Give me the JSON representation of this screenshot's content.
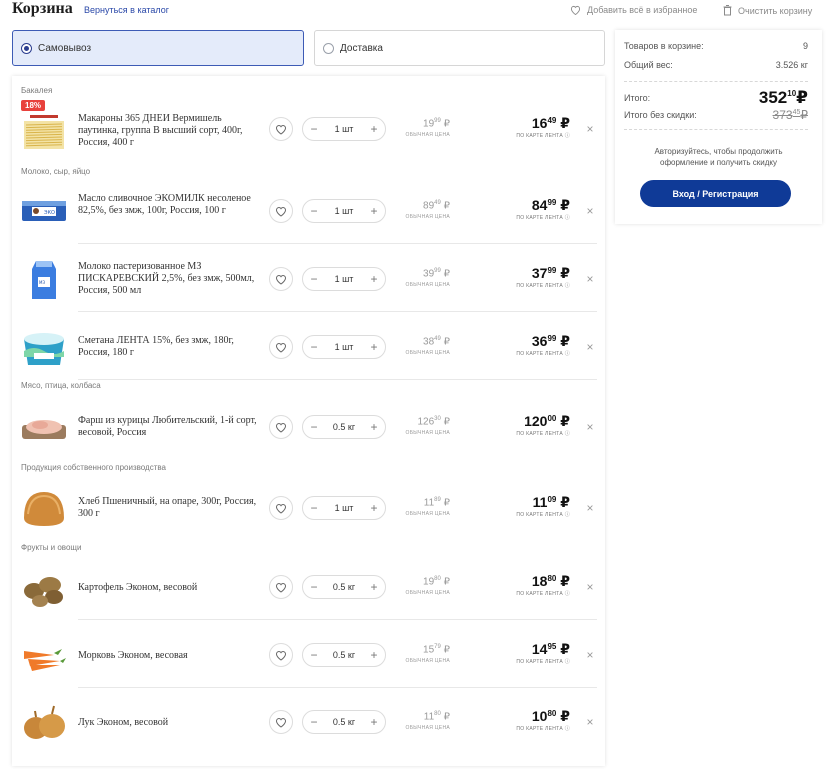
{
  "header": {
    "title": "Корзина",
    "back_link": "Вернуться в каталог",
    "add_all_favorites": "Добавить всё в избранное",
    "clear_cart": "Очистить корзину"
  },
  "delivery": {
    "pickup": "Самовывоз",
    "courier": "Доставка",
    "selected": "pickup"
  },
  "labels": {
    "regular_price": "ОБЫЧНАЯ ЦЕНА",
    "card_price": "ПО КАРТЕ ЛЕНТА ⓘ",
    "currency": "₽"
  },
  "categories": [
    {
      "name": "Бакалея"
    },
    {
      "name": "Молоко, сыр, яйцо"
    },
    {
      "name": "Мясо, птица, колбаса"
    },
    {
      "name": "Продукция собственного производства"
    },
    {
      "name": "Фрукты и овощи"
    }
  ],
  "items": [
    {
      "name": "Макароны 365 ДНЕИ Вермишель паутинка, группа В высший сорт, 400г, Россия, 400 г",
      "qty": "1 шт",
      "old_int": "19",
      "old_frac": "99",
      "price_int": "16",
      "price_frac": "49",
      "badge": "18%",
      "image": "pasta-image"
    },
    {
      "name": "Масло сливочное ЭКОМИЛК несоленое 82,5%, без змж, 100г, Россия, 100 г",
      "qty": "1 шт",
      "old_int": "89",
      "old_frac": "49",
      "price_int": "84",
      "price_frac": "99",
      "image": "butter-image"
    },
    {
      "name": "Молоко пастеризованное МЗ ПИСКАРЕВСКИЙ 2,5%, без змж, 500мл, Россия, 500 мл",
      "qty": "1 шт",
      "old_int": "39",
      "old_frac": "99",
      "price_int": "37",
      "price_frac": "99",
      "image": "milk-image"
    },
    {
      "name": "Сметана ЛЕНТА 15%, без змж, 180г, Россия, 180 г",
      "qty": "1 шт",
      "old_int": "38",
      "old_frac": "49",
      "price_int": "36",
      "price_frac": "99",
      "image": "sour-cream-image"
    },
    {
      "name": "Фарш из курицы Любительский, 1-й сорт, весовой, Россия",
      "qty": "0.5 кг",
      "old_int": "126",
      "old_frac": "30",
      "price_int": "120",
      "price_frac": "00",
      "image": "minced-meat-image"
    },
    {
      "name": "Хлеб Пшеничный, на опаре, 300г, Россия, 300 г",
      "qty": "1 шт",
      "old_int": "11",
      "old_frac": "89",
      "price_int": "11",
      "price_frac": "09",
      "image": "bread-image"
    },
    {
      "name": "Картофель Эконом, весовой",
      "qty": "0.5 кг",
      "old_int": "19",
      "old_frac": "80",
      "price_int": "18",
      "price_frac": "80",
      "image": "potato-image"
    },
    {
      "name": "Морковь Эконом, весовая",
      "qty": "0.5 кг",
      "old_int": "15",
      "old_frac": "79",
      "price_int": "14",
      "price_frac": "95",
      "image": "carrot-image"
    },
    {
      "name": "Лук Эконом, весовой",
      "qty": "0.5 кг",
      "old_int": "11",
      "old_frac": "80",
      "price_int": "10",
      "price_frac": "80",
      "image": "onion-image"
    }
  ],
  "summary": {
    "items_label": "Товаров в корзине:",
    "items_value": "9",
    "weight_label": "Общий вес:",
    "weight_value": "3.526 кг",
    "total_label": "Итого:",
    "total_int": "352",
    "total_frac": "10",
    "nodisc_label": "Итого без скидки:",
    "nodisc_int": "373",
    "nodisc_frac": "45",
    "auth_text": "Авторизуйтесь, чтобы продолжить оформление и получить скидку",
    "login_button": "Вход / Регистрация"
  },
  "colors": {
    "accent": "#0f3a97",
    "selected_bg": "#e4ebfa",
    "badge": "#e8413c"
  }
}
